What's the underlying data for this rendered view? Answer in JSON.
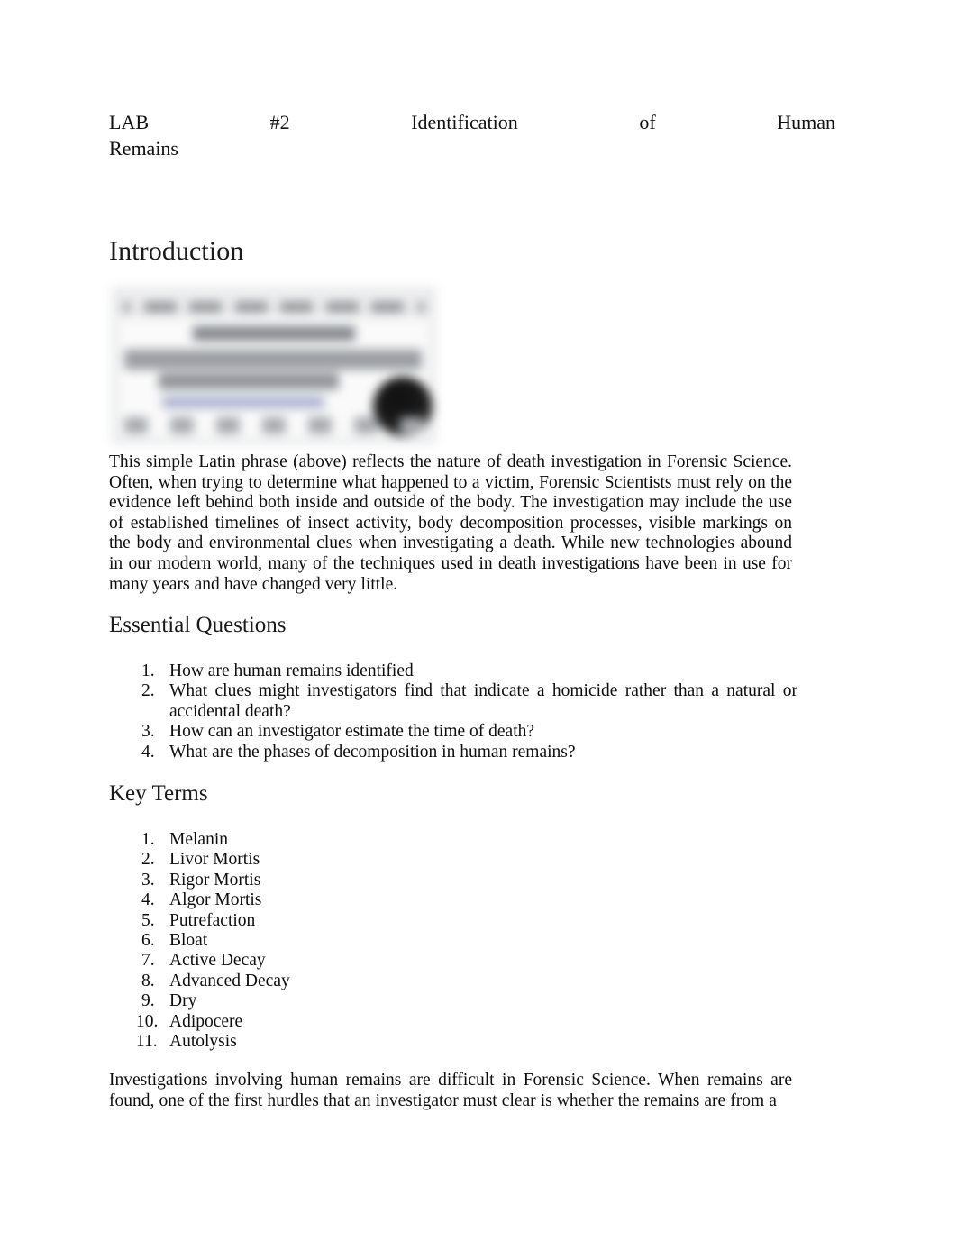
{
  "document": {
    "header": {
      "lab_label": "LAB #2",
      "title_words": [
        "Identification",
        "of",
        "Human"
      ],
      "title_overflow": "Remains"
    },
    "sections": {
      "introduction": {
        "heading": "Introduction",
        "figure": {
          "alt": "blurred-latin-phrase-graphic",
          "description": "Blurred screenshot of a web page showing a Latin phrase with a dark skull illustration"
        },
        "paragraph": "This simple Latin phrase (above) reflects the nature of death investigation in Forensic Science. Often, when trying to determine what happened to a victim, Forensic Scientists must rely on the evidence left behind both inside and outside of the body. The investigation may include the use of established timelines of insect activity, body decomposition processes, visible markings on the body and environmental clues when investigating a death. While new technologies abound in our modern world, many of the techniques used in death investigations have been in use for many years and have changed very little."
      },
      "essential_questions": {
        "heading": "Essential Questions",
        "items": [
          {
            "number": "1.",
            "text": "How are human remains identified"
          },
          {
            "number": "2.",
            "text": "What clues might investigators find that indicate a homicide rather than a natural or accidental death?"
          },
          {
            "number": "3.",
            "text": "How can an investigator estimate the time of death?"
          },
          {
            "number": "4.",
            "text": "What are the phases of decomposition in human remains?"
          }
        ]
      },
      "key_terms": {
        "heading": "Key Terms",
        "items": [
          {
            "number": "1.",
            "text": "Melanin"
          },
          {
            "number": "2.",
            "text": "Livor Mortis"
          },
          {
            "number": "3.",
            "text": "Rigor Mortis"
          },
          {
            "number": "4.",
            "text": "Algor Mortis"
          },
          {
            "number": "5.",
            "text": "Putrefaction"
          },
          {
            "number": "6.",
            "text": "Bloat"
          },
          {
            "number": "7.",
            "text": "Active Decay"
          },
          {
            "number": "8.",
            "text": "Advanced Decay"
          },
          {
            "number": "9.",
            "text": "Dry"
          },
          {
            "number": "10.",
            "text": "Adipocere"
          },
          {
            "number": "11.",
            "text": "Autolysis"
          }
        ]
      },
      "closing": {
        "paragraph": "Investigations involving human remains are difficult in Forensic Science. When remains are found, one of the first hurdles that an investigator must clear is whether the remains are from a"
      }
    }
  }
}
